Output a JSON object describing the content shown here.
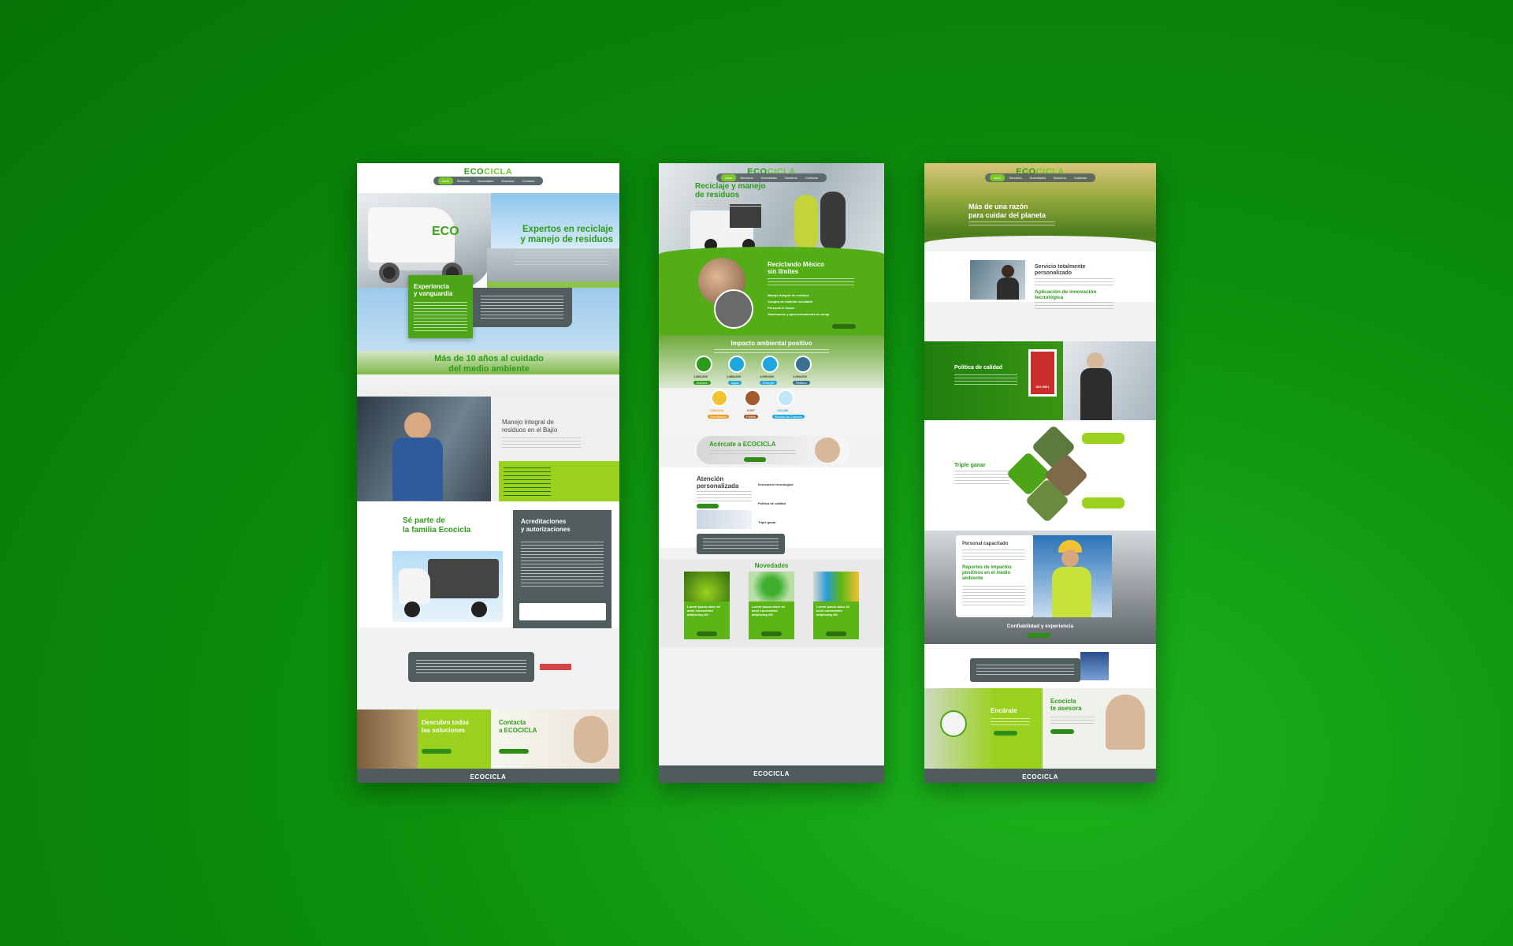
{
  "brand": {
    "logo_a": "ECO",
    "logo_b": "CICLA"
  },
  "colors": {
    "bg_green": "#0c8f0c",
    "brand_green": "#4ba516",
    "lime": "#9ad11e",
    "slate": "#505c5e"
  },
  "page1": {
    "nav": [
      "Inicio",
      "Servicios",
      "Novedades",
      "Nosotros",
      "Contacto"
    ],
    "hero_title_1": "Expertos en reciclaje",
    "hero_title_2": "y manejo de residuos",
    "exp_title_1": "Experiencia",
    "exp_title_2": "y vanguardia",
    "decade_title_1": "Más de 10 años al cuidado",
    "decade_title_2": "del medio ambiente",
    "manejo_title_1": "Manejo integral de",
    "manejo_title_2": "residuos en el Bajío",
    "familia_title_1": "Sé parte de",
    "familia_title_2": "la familia Ecocicla",
    "acred_title_1": "Acreditaciones",
    "acred_title_2": "y autorizaciones",
    "descubre_title_1": "Descubre todas",
    "descubre_title_2": "las soluciones",
    "contacta_title_1": "Contacta",
    "contacta_title_2": "a ECOCICLA"
  },
  "page2": {
    "nav": [
      "Inicio",
      "Servicios",
      "Novedades",
      "Nosotros",
      "Contacto"
    ],
    "hero_title_1": "Reciclaje y manejo",
    "hero_title_2": "de residuos",
    "mx_title_1": "Reciclando México",
    "mx_title_2": "sin límites",
    "mx_list": [
      "Manejo integral de residuos",
      "Compra de material reciclable",
      "Personal in house",
      "Valorización y aprovechamiento de scrap"
    ],
    "impacto_title": "Impacto ambiental positivo",
    "impact_values_1": [
      "1,800,000",
      "1,983,000",
      "1,090,000",
      "1,000,000"
    ],
    "impact_labels_1": [
      "Árboles",
      "Agua",
      "Energía",
      "Relleno"
    ],
    "impact_values_2": [
      "7,080,000",
      "5,897",
      "110,000"
    ],
    "impact_labels_2": [
      "Electricidad",
      "Pallets",
      "Bióxido de Carbono"
    ],
    "acercate_title": "Acércate a ECOCICLA",
    "atencion_title_1": "Atención",
    "atencion_title_2": "personalizada",
    "atencion_list": [
      "Innovación tecnológica",
      "Política de calidad",
      "Triple ganar"
    ],
    "novedades_title": "Novedades",
    "news_cards": [
      "Lorem ipsum dolor sit amet consectetur adipiscing elit",
      "Lorem ipsum dolor sit amet consectetur adipiscing elit",
      "Lorem ipsum dolor sit amet consectetur adipiscing elit"
    ]
  },
  "page3": {
    "nav": [
      "Inicio",
      "Servicios",
      "Novedades",
      "Nosotros",
      "Contacto"
    ],
    "hero_title_1": "Más de una razón",
    "hero_title_2": "para cuidar del planeta",
    "servicio_title_1": "Servicio totalmente",
    "servicio_title_2": "personalizado",
    "innov_title_1": "Aplicación de innovación",
    "innov_title_2": "tecnológica",
    "calidad_title": "Política de calidad",
    "iso_label": "ISO 9001",
    "triple_title": "Triple ganar",
    "personal_title": "Personal capacitado",
    "reportes_title_1": "Reportes de impactos",
    "reportes_title_2": "positivos en el medio",
    "reportes_title_3": "ambiente",
    "confiab_title": "Confiabilidad y experiencia",
    "encarate_title": "Encárate",
    "asesora_title_1": "Ecocicla",
    "asesora_title_2": "te asesora"
  }
}
